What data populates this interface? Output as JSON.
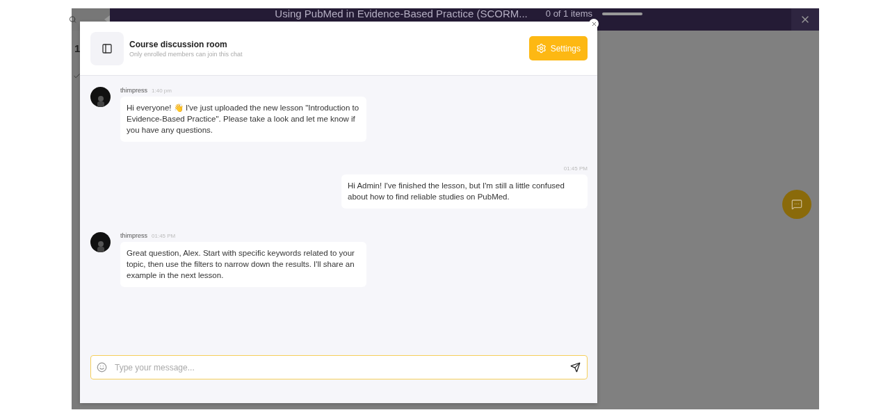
{
  "background": {
    "title": "Using PubMed in Evidence-Based Practice (SCORM...",
    "progress_text": "0 of 1 items",
    "progress": {
      "level": 0
    },
    "side_number": "1"
  },
  "chat": {
    "title": "Course discussion room",
    "subtitle": "Only enrolled members can join this chat",
    "settings_label": "Settings",
    "messages": [
      {
        "kind": "incoming",
        "author": "thimpress",
        "time": "1:40 pm",
        "text": "Hi everyone! 👋 I've just uploaded the new lesson \"Introduction to Evidence-Based Practice\". Please take a look and let me know if you have any questions."
      },
      {
        "kind": "outgoing",
        "time": "01:45 PM",
        "text": "Hi Admin! I've finished the lesson, but I'm still a little confused about how to find reliable studies on PubMed."
      },
      {
        "kind": "incoming",
        "author": "thimpress",
        "time": "01:45 PM",
        "text": "Great question, Alex. Start with specific keywords related to your topic, then use the filters to narrow down the results. I'll share an example in the next lesson."
      }
    ],
    "input": {
      "placeholder": "Type your message..."
    }
  }
}
